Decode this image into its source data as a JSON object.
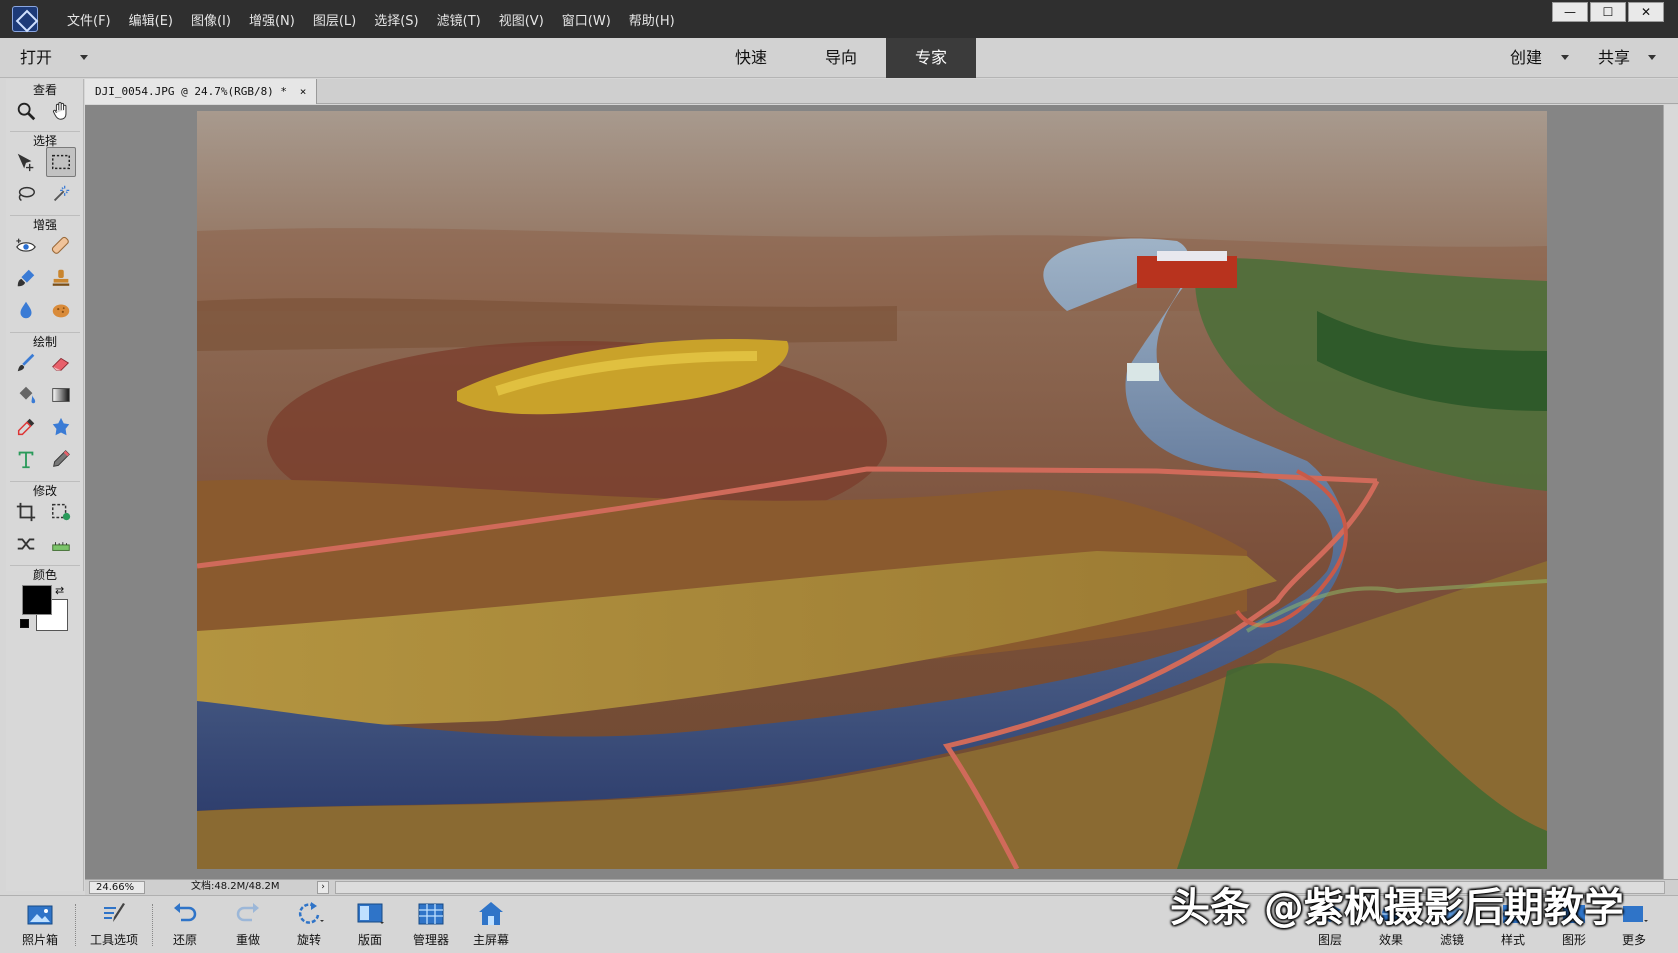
{
  "menubar": {
    "items": [
      "文件(F)",
      "编辑(E)",
      "图像(I)",
      "增强(N)",
      "图层(L)",
      "选择(S)",
      "滤镜(T)",
      "视图(V)",
      "窗口(W)",
      "帮助(H)"
    ]
  },
  "window_controls": {
    "minimize": "—",
    "maximize": "☐",
    "close": "✕"
  },
  "modebar": {
    "open_label": "打开",
    "tabs": [
      {
        "label": "快速",
        "active": false
      },
      {
        "label": "导向",
        "active": false
      },
      {
        "label": "专家",
        "active": true
      }
    ],
    "create_label": "创建",
    "share_label": "共享"
  },
  "toolbox": {
    "sections": [
      "查看",
      "选择",
      "增强",
      "绘制",
      "修改",
      "颜色"
    ],
    "tools": {
      "view": [
        "zoom-icon",
        "hand-icon"
      ],
      "select": [
        "move-icon",
        "marquee-icon",
        "lasso-icon",
        "magic-wand-icon"
      ],
      "enhance": [
        "red-eye-icon",
        "spot-healing-icon",
        "smart-brush-icon",
        "clone-stamp-icon",
        "blur-icon",
        "sponge-icon"
      ],
      "draw": [
        "brush-icon",
        "eraser-icon",
        "paint-bucket-icon",
        "gradient-icon",
        "eyedropper-icon",
        "custom-shape-icon",
        "type-icon",
        "pencil-icon"
      ],
      "modify": [
        "crop-icon",
        "recompose-icon",
        "content-aware-move-icon",
        "straighten-icon"
      ]
    },
    "foreground_color": "#000000",
    "background_color": "#ffffff"
  },
  "document": {
    "tab_title": "DJI_0054.JPG @ 24.7%(RGB/8) *",
    "close_glyph": "×"
  },
  "statusbar": {
    "zoom": "24.66%",
    "doc_size": "文档:48.2M/48.2M",
    "arrow": "›"
  },
  "taskbar": {
    "left_buttons": [
      {
        "name": "photo-bin",
        "label": "照片箱"
      },
      {
        "name": "tool-options",
        "label": "工具选项"
      },
      {
        "name": "undo",
        "label": "还原"
      },
      {
        "name": "redo",
        "label": "重做"
      },
      {
        "name": "rotate",
        "label": "旋转"
      },
      {
        "name": "layout",
        "label": "版面"
      },
      {
        "name": "organizer",
        "label": "管理器"
      },
      {
        "name": "home-screen",
        "label": "主屏幕"
      }
    ],
    "right_buttons": [
      {
        "name": "layers",
        "label": "图层"
      },
      {
        "name": "effects",
        "label": "效果"
      },
      {
        "name": "filters",
        "label": "滤镜"
      },
      {
        "name": "styles",
        "label": "样式"
      },
      {
        "name": "graphics",
        "label": "图形"
      },
      {
        "name": "more",
        "label": "更多"
      }
    ]
  },
  "watermark": "头条 @紫枫摄影后期教学"
}
